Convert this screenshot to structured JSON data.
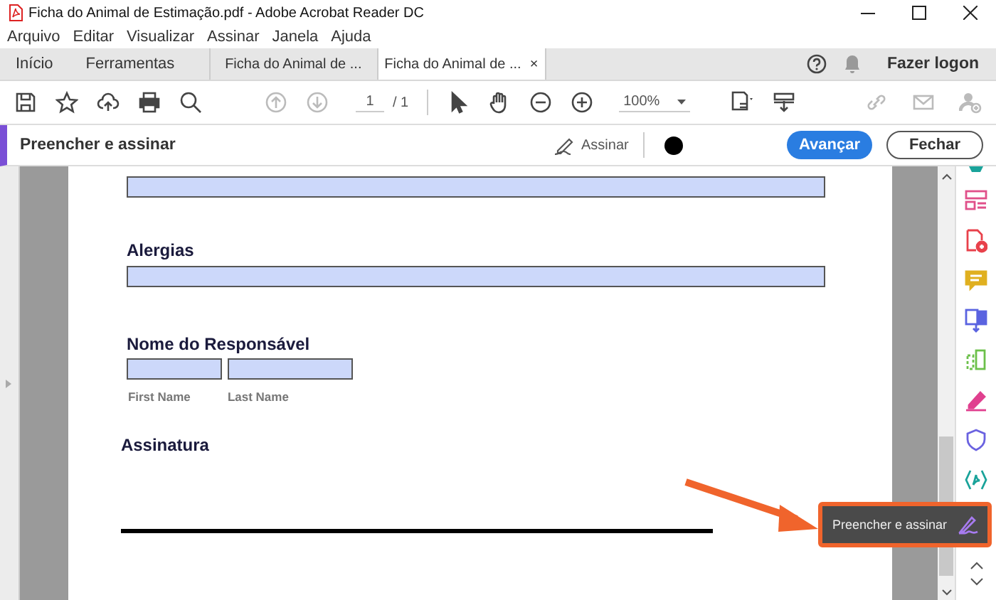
{
  "window": {
    "title": "Ficha do Animal de Estimação.pdf - Adobe Acrobat Reader DC"
  },
  "menu": [
    "Arquivo",
    "Editar",
    "Visualizar",
    "Assinar",
    "Janela",
    "Ajuda"
  ],
  "tabs": [
    {
      "label": "Início",
      "kind": "home",
      "selected": false
    },
    {
      "label": "Ferramentas",
      "kind": "home",
      "selected": false
    },
    {
      "label": "Ficha do Animal de ...",
      "kind": "document",
      "selected": false
    },
    {
      "label": "Ficha do Animal de ...",
      "kind": "document",
      "selected": true,
      "close": "×"
    }
  ],
  "account": {
    "label": "Fazer logon"
  },
  "toolbar": {
    "page": "1",
    "page_total": "/ 1",
    "zoom": "100%"
  },
  "fill_sign": {
    "title": "Preencher e assinar",
    "sign": "Assinar",
    "primary": "Avançar",
    "close": "Fechar"
  },
  "form": [
    {
      "kind": "field"
    },
    {
      "kind": "label",
      "text": "Alergias"
    },
    {
      "kind": "field"
    },
    {
      "kind": "label",
      "text": "Nome do Responsável"
    },
    {
      "kind": "name",
      "parts": [
        "First Name",
        "Last Name"
      ]
    },
    {
      "kind": "signature",
      "text": "Assinatura"
    }
  ],
  "tooltip": {
    "label": "Preencher e assinar"
  }
}
